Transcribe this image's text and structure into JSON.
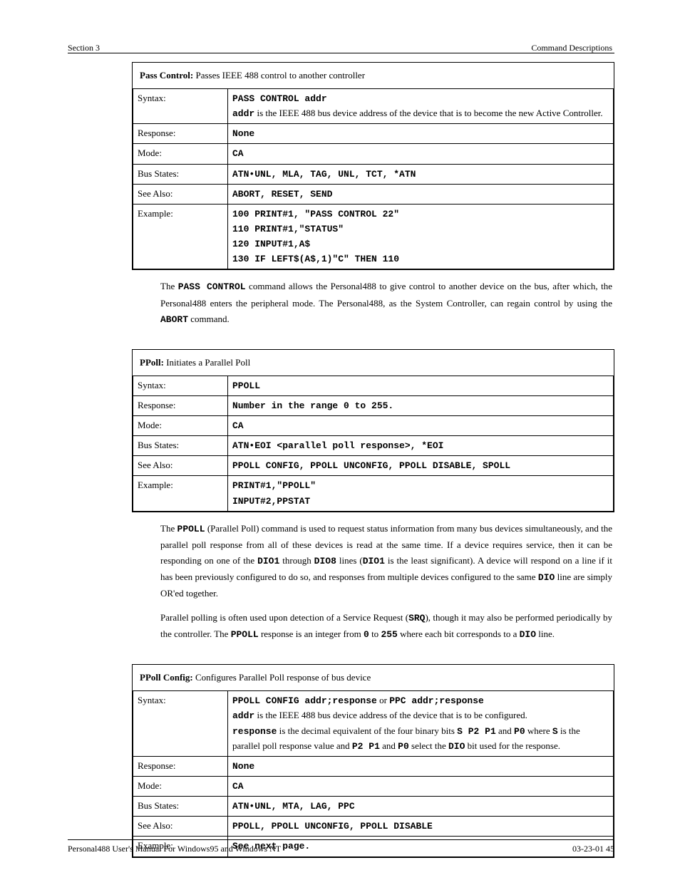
{
  "header": {
    "left": "Section 3",
    "right": "Command Descriptions"
  },
  "footer": {
    "left": "Personal488 User's Manual For Windows95 and Windows NT",
    "right": "03-23-01   45"
  },
  "boxes": [
    {
      "title_prefix": "Pass Control:",
      "title_rest": " Passes IEEE 488 control to another controller",
      "rows": [
        {
          "label": "Syntax:",
          "value_html": "<span class='mono'>PASS CONTROL addr</span><br><span class='mono'>addr</span> is the IEEE 488 bus device address of the device that is to become the new Active Controller."
        },
        {
          "label": "Response:",
          "value_html": "<span class='mono'>None</span>"
        },
        {
          "label": "Mode:",
          "value_html": "<span class='mono'>CA</span>"
        },
        {
          "label": "Bus States:",
          "value_html": "<span class='mono'>ATN&bull;UNL, MLA, TAG, UNL, TCT, *ATN</span>"
        },
        {
          "label": "See Also:",
          "value_html": "<span class='mono'>ABORT, RESET, SEND</span>"
        },
        {
          "label": "Example:",
          "value_html": "<span class='mono multiline'>100 PRINT#1, \"PASS CONTROL 22\"\n110 PRINT#1,\"STATUS\"\n120 INPUT#1,A$\n130 IF LEFT$(A$,1)\"C\" THEN 110</span>"
        }
      ]
    },
    {
      "title_prefix": "PPoll:",
      "title_rest": " Initiates a Parallel Poll",
      "rows": [
        {
          "label": "Syntax:",
          "value_html": "<span class='mono'>PPOLL</span>"
        },
        {
          "label": "Response:",
          "value_html": "<span class='mono'>Number in the range 0 to 255.</span>"
        },
        {
          "label": "Mode:",
          "value_html": "<span class='mono'>CA</span>"
        },
        {
          "label": "Bus States:",
          "value_html": "<span class='mono'>ATN&bull;EOI &lt;parallel poll response&gt;, *EOI</span>"
        },
        {
          "label": "See Also:",
          "value_html": "<span class='mono'>PPOLL CONFIG, PPOLL UNCONFIG, PPOLL DISABLE, SPOLL</span>"
        },
        {
          "label": "Example:",
          "value_html": "<span class='mono multiline'>PRINT#1,\"PPOLL\"\nINPUT#2,PPSTAT</span>"
        }
      ]
    },
    {
      "title_prefix": "PPoll Config:",
      "title_rest": " Configures Parallel Poll response of bus device",
      "rows": [
        {
          "label": "Syntax:",
          "value_html": "<span class='mono'>PPOLL CONFIG addr;response</span> or <span class='mono'>PPC addr;response</span><br><span class='mono'>addr</span> is the IEEE 488 bus device address of the device that is to be configured.<br><span class='mono'>response</span> is the decimal equivalent of the four binary bits <span class='mono'>S P2 P1</span> and <span class='mono'>P0</span> where <span class='mono'>S</span> is the parallel poll response value and <span class='mono'>P2 P1</span> and <span class='mono'>P0</span> select the <span class='mono'>DIO</span> bit used for the response."
        },
        {
          "label": "Response:",
          "value_html": "<span class='mono'>None</span>"
        },
        {
          "label": "Mode:",
          "value_html": "<span class='mono'>CA</span>"
        },
        {
          "label": "Bus States:",
          "value_html": "<span class='mono'>ATN&bull;UNL, MTA, LAG, PPC</span>"
        },
        {
          "label": "See Also:",
          "value_html": "<span class='mono'>PPOLL, PPOLL UNCONFIG, PPOLL DISABLE</span>"
        },
        {
          "label": "Example:",
          "value_html": "<span class='mono'>See next page.</span>"
        }
      ]
    }
  ],
  "paragraphs": [
    "The <span class='mono'>PASS CONTROL</span> command allows the Personal488 to give control to another device on the bus, after which, the Personal488 enters the peripheral mode. The Personal488, as the System Controller, can regain control by using the <span class='mono'>ABORT</span> command.",
    "The <span class='mono'>PPOLL</span> (Parallel Poll) command is used to request status information from many bus devices simultaneously, and the parallel poll response from all of these devices is read at the same time. If a device requires service, then it can be responding on one of the <span class='mono'>DIO1</span> through <span class='mono'>DIO8</span> lines (<span class='mono'>DIO1</span> is the least significant). A device will respond on a line if it has been previously configured to do so, and responses from multiple devices configured to the same <span class='mono'>DIO</span> line are simply OR'ed together.",
    "Parallel polling is often used upon detection of a Service Request (<span class='mono'>SRQ</span>), though it may also be performed periodically by the controller. The <span class='mono'>PPOLL</span> response is an integer from <span class='mono'>0</span> to <span class='mono'>255</span> where each bit corresponds to a <span class='mono'>DIO</span> line."
  ]
}
